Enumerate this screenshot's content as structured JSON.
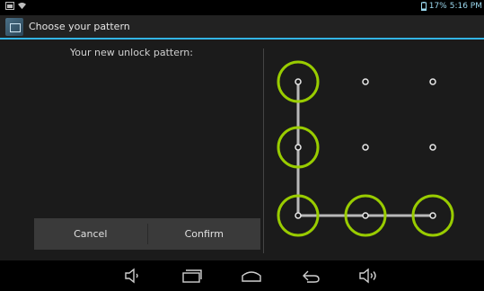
{
  "status_bar": {
    "battery": "17%",
    "time": "5:16 PM",
    "icons": [
      "screenshot-icon",
      "wifi-icon",
      "battery-icon"
    ]
  },
  "action_bar": {
    "title": "Choose your pattern",
    "icon": "pattern-lock-icon"
  },
  "screen": {
    "header": "Your new unlock pattern:",
    "cancel_label": "Cancel",
    "confirm_label": "Confirm"
  },
  "pattern": {
    "path": [
      0,
      3,
      6,
      7,
      8
    ],
    "accent_color": "#99cc00",
    "line_color": "#b9b9b9"
  },
  "nav_bar": {
    "icons": [
      "volume-down-icon",
      "recent-apps-icon",
      "home-icon",
      "back-icon",
      "volume-up-icon"
    ]
  },
  "colors": {
    "accent_blue": "#33b5e5",
    "pattern_green": "#99cc00"
  }
}
